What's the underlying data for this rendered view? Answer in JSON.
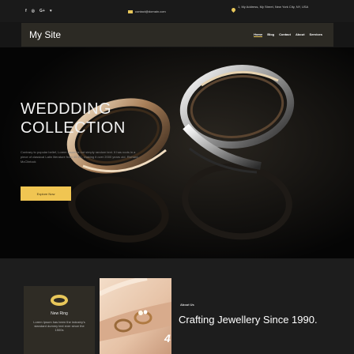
{
  "topbar": {
    "social": [
      {
        "icon": "facebook-icon",
        "glyph": "f"
      },
      {
        "icon": "instagram-icon",
        "glyph": "◎"
      },
      {
        "icon": "google-plus-icon",
        "glyph": "G+"
      },
      {
        "icon": "twitter-icon",
        "glyph": "♥"
      }
    ],
    "email": "contact@domain.com",
    "address": "1, My Address, My Street, New York City, NY, USA"
  },
  "nav": {
    "brand": "My Site",
    "items": [
      "Home",
      "Blog",
      "Contact",
      "About",
      "Services"
    ],
    "active": "Home"
  },
  "hero": {
    "title_line1": "WEDDDING",
    "title_line2": "COLLECTION",
    "description": "Contrary to popular belief, Lorem Ipsum is not simply random text. It has roots in a piece of classical Latin literature from 45 BC, making it over 2000 years old. Richard McClintock",
    "button_label": "Explore Now"
  },
  "about": {
    "card_title": "New Ring",
    "card_desc": "Lorem Ipsum has been the industry's standard dummy text ever since the 1500s",
    "label": "About Us",
    "heading": "Crafting Jewellery Since 1990."
  },
  "colors": {
    "accent": "#f0c552",
    "nav_bg": "#2c2a24",
    "page_bg": "#161616"
  }
}
